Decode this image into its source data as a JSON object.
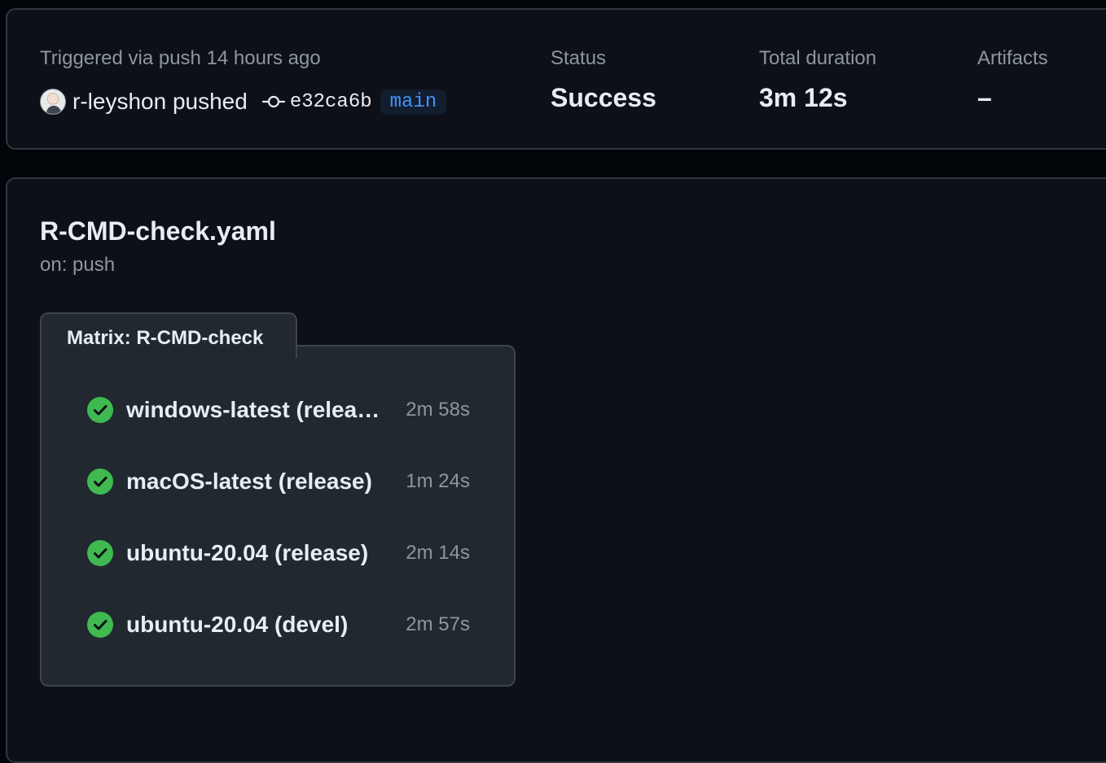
{
  "summary": {
    "trigger_text": "Triggered via push 14 hours ago",
    "actor": "r-leyshon pushed",
    "commit_sha": "e32ca6b",
    "branch": "main",
    "status_label": "Status",
    "status_value": "Success",
    "duration_label": "Total duration",
    "duration_value": "3m 12s",
    "artifacts_label": "Artifacts",
    "artifacts_value": "–"
  },
  "workflow": {
    "title": "R-CMD-check.yaml",
    "trigger": "on: push",
    "matrix_label": "Matrix: R-CMD-check",
    "jobs": [
      {
        "name": "windows-latest (releas…",
        "duration": "2m 58s",
        "status": "success"
      },
      {
        "name": "macOS-latest (release)",
        "duration": "1m 24s",
        "status": "success"
      },
      {
        "name": "ubuntu-20.04 (release)",
        "duration": "2m 14s",
        "status": "success"
      },
      {
        "name": "ubuntu-20.04 (devel)",
        "duration": "2m 57s",
        "status": "success"
      }
    ]
  },
  "icons": {
    "commit": "git-commit-icon",
    "success": "check-circle-icon"
  },
  "colors": {
    "success": "#3fb950",
    "link": "#4493f8",
    "muted": "#8d96a0"
  }
}
